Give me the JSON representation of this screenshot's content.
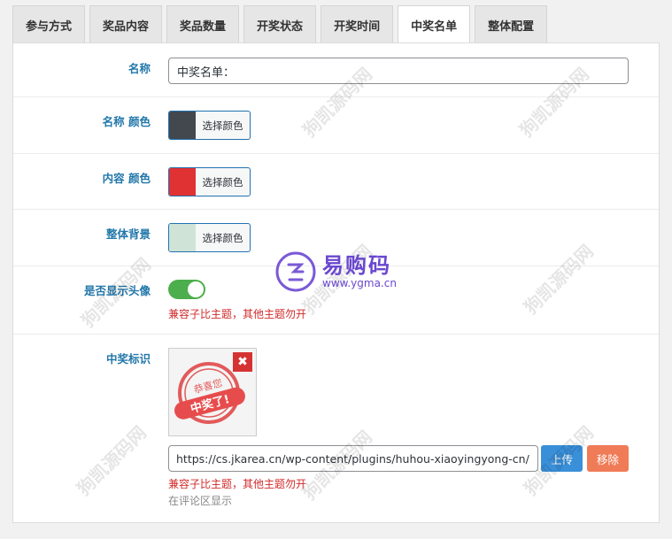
{
  "tabs": [
    {
      "label": "参与方式"
    },
    {
      "label": "奖品内容"
    },
    {
      "label": "奖品数量"
    },
    {
      "label": "开奖状态"
    },
    {
      "label": "开奖时间"
    },
    {
      "label": "中奖名单"
    },
    {
      "label": "整体配置"
    }
  ],
  "active_tab": "中奖名单",
  "fields": {
    "name": {
      "label": "名称",
      "value": "中奖名单："
    },
    "name_color": {
      "label": "名称 颜色",
      "button": "选择颜色",
      "color": "#43474e"
    },
    "content_color": {
      "label": "内容 颜色",
      "button": "选择颜色",
      "color": "#e03232"
    },
    "background": {
      "label": "整体背景",
      "button": "选择颜色",
      "color": "#cfe4d6"
    },
    "show_avatar": {
      "label": "是否显示头像",
      "enabled": true,
      "toggle_color": "#4cae4c",
      "hint": "兼容子比主题，其他主题勿开"
    },
    "badge": {
      "label": "中奖标识",
      "image_text_top": "恭喜您",
      "image_text_main": "中奖了!",
      "url": "https://cs.jkarea.cn/wp-content/plugins/huhou-xiaoyingyong-cn/",
      "upload_label": "上传",
      "remove_label": "移除",
      "hint": "兼容子比主题，其他主题勿开",
      "sub_hint": "在评论区显示"
    }
  },
  "watermark_text": "狗凯源码网",
  "logo": {
    "name": "易购码",
    "url": "www.ygma.cn"
  },
  "colors": {
    "label_blue": "#2277aa",
    "upload_blue": "#3a8fd9",
    "remove_orange": "#f07b57",
    "hint_red": "#d12a2a"
  }
}
